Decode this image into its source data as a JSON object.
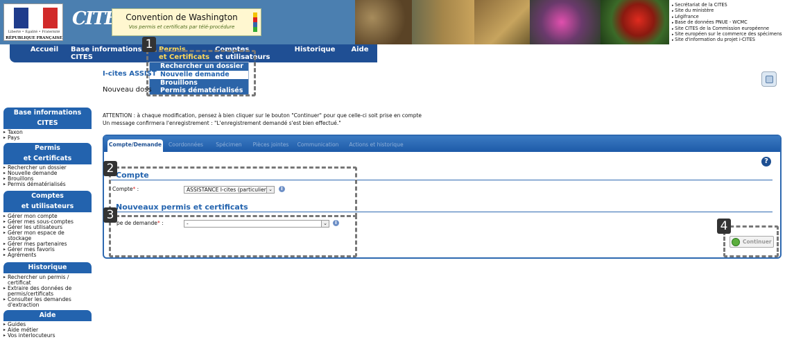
{
  "header": {
    "motto": "Liberté • Égalité • Fraternité",
    "republic": "RÉPUBLIQUE FRANÇAISE",
    "cites_logo": "CITES",
    "title": "Convention de Washington",
    "subtitle": "Vos permis et certificats par télé-procédure",
    "site_links": [
      "Secrétariat de la CITES",
      "Site du ministère",
      "Légifrance",
      "Base de données PNUE - WCMC",
      "Site CITES de la Commission européenne",
      "Site européen sur le commerce des spécimens",
      "Site d'information du projet i-CITES"
    ]
  },
  "nav": {
    "accueil": "Accueil",
    "base_info_1": "Base informations",
    "base_info_2": "CITES",
    "permis_1": "Permis",
    "permis_2": "et Certificats",
    "comptes_1": "Comptes",
    "comptes_2": "et utilisateurs",
    "historique": "Historique",
    "aide": "Aide",
    "dropdown": [
      "Rechercher un dossier",
      "Nouvelle demande",
      "Brouillons",
      "Permis dématérialisés"
    ]
  },
  "badges": [
    "1",
    "2",
    "3",
    "4"
  ],
  "sidebar": {
    "base_head_1": "Base informations",
    "base_head_2": "CITES",
    "base_items": [
      "Taxon",
      "Pays"
    ],
    "permis_head_1": "Permis",
    "permis_head_2": "et Certificats",
    "permis_items": [
      "Rechercher un dossier",
      "Nouvelle demande",
      "Brouillons",
      "Permis dématérialisés"
    ],
    "comptes_head_1": "Comptes",
    "comptes_head_2": "et utilisateurs",
    "comptes_items": [
      "Gérer mon compte",
      "Gérer mes sous-comptes",
      "Gérer les utilisateurs",
      "Gérer mon espace de stockage",
      "Gérer mes partenaires",
      "Gérer mes favoris",
      "Agréments"
    ],
    "historique_head": "Historique",
    "historique_items": [
      "Rechercher un permis / certificat",
      "Extraire des données de permis/certificats",
      "Consulter les demandes d'extraction"
    ],
    "aide_head": "Aide",
    "aide_items": [
      "Guides",
      "Aide métier",
      "Vos interlocuteurs"
    ]
  },
  "main": {
    "page_title": "I-cites ASSIST",
    "subtitle": "Nouveau doss",
    "attention": "ATTENTION : à chaque modification, pensez à bien cliquer sur le bouton \"Continuer\" pour que celle-ci soit prise en compte",
    "message": "Un message confirmera l'enregistrement : \"L'enregistrement demandé s'est bien effectué.\"",
    "tabs": [
      "Compte/Demande",
      "Coordonnées",
      "Spécimen",
      "Pièces jointes",
      "Communication",
      "Actions et historique"
    ],
    "help_icon": "?",
    "compte_section": "Compte",
    "compte_label": "Compte",
    "compte_value": "ASSISTANCE I-cites (particulier)",
    "permis_section": "Nouveaux permis et certificats",
    "type_label": "pe de demande",
    "type_value": "-",
    "required_mark": "*",
    "info_icon": "i",
    "continue": "Continuer"
  }
}
